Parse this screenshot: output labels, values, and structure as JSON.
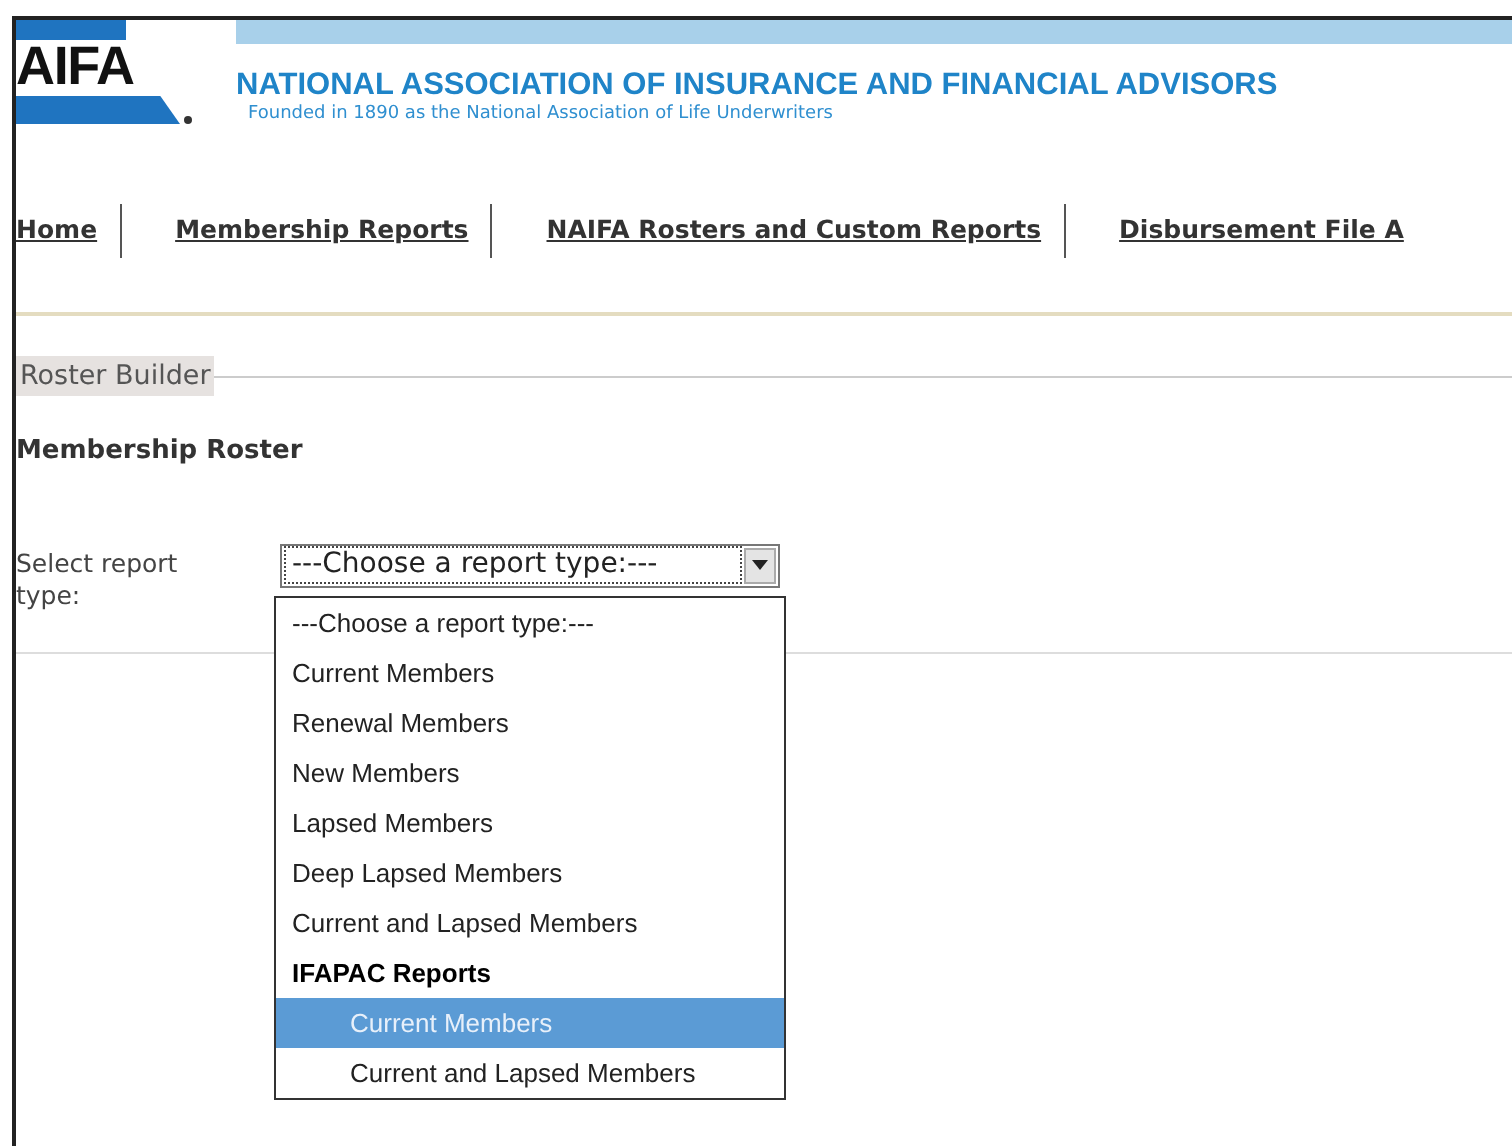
{
  "header": {
    "logo": "AIFA",
    "title": "NATIONAL ASSOCIATION OF INSURANCE AND FINANCIAL ADVISORS",
    "subtitle": "Founded in 1890 as the National Association of Life Underwriters"
  },
  "nav": [
    {
      "label": "Home"
    },
    {
      "label": "Membership Reports"
    },
    {
      "label": "NAIFA Rosters and Custom Reports"
    },
    {
      "label": "Disbursement File A"
    }
  ],
  "section": {
    "legend": "Roster Builder",
    "heading": "Membership Roster",
    "field_label": "Select report type:",
    "select": {
      "value": "---Choose a report type:---",
      "expanded": true
    }
  },
  "options": [
    {
      "kind": "option",
      "label": "---Choose a report type:---",
      "selected": false
    },
    {
      "kind": "option",
      "label": "Current Members",
      "selected": false
    },
    {
      "kind": "option",
      "label": "Renewal Members",
      "selected": false
    },
    {
      "kind": "option",
      "label": "New Members",
      "selected": false
    },
    {
      "kind": "option",
      "label": "Lapsed Members",
      "selected": false
    },
    {
      "kind": "option",
      "label": "Deep Lapsed Members",
      "selected": false
    },
    {
      "kind": "option",
      "label": "Current and Lapsed Members",
      "selected": false
    },
    {
      "kind": "group",
      "label": "IFAPAC Reports",
      "children": [
        {
          "kind": "option",
          "label": "Current Members",
          "selected": true
        },
        {
          "kind": "option",
          "label": "Current and Lapsed Members",
          "selected": false
        }
      ]
    }
  ]
}
